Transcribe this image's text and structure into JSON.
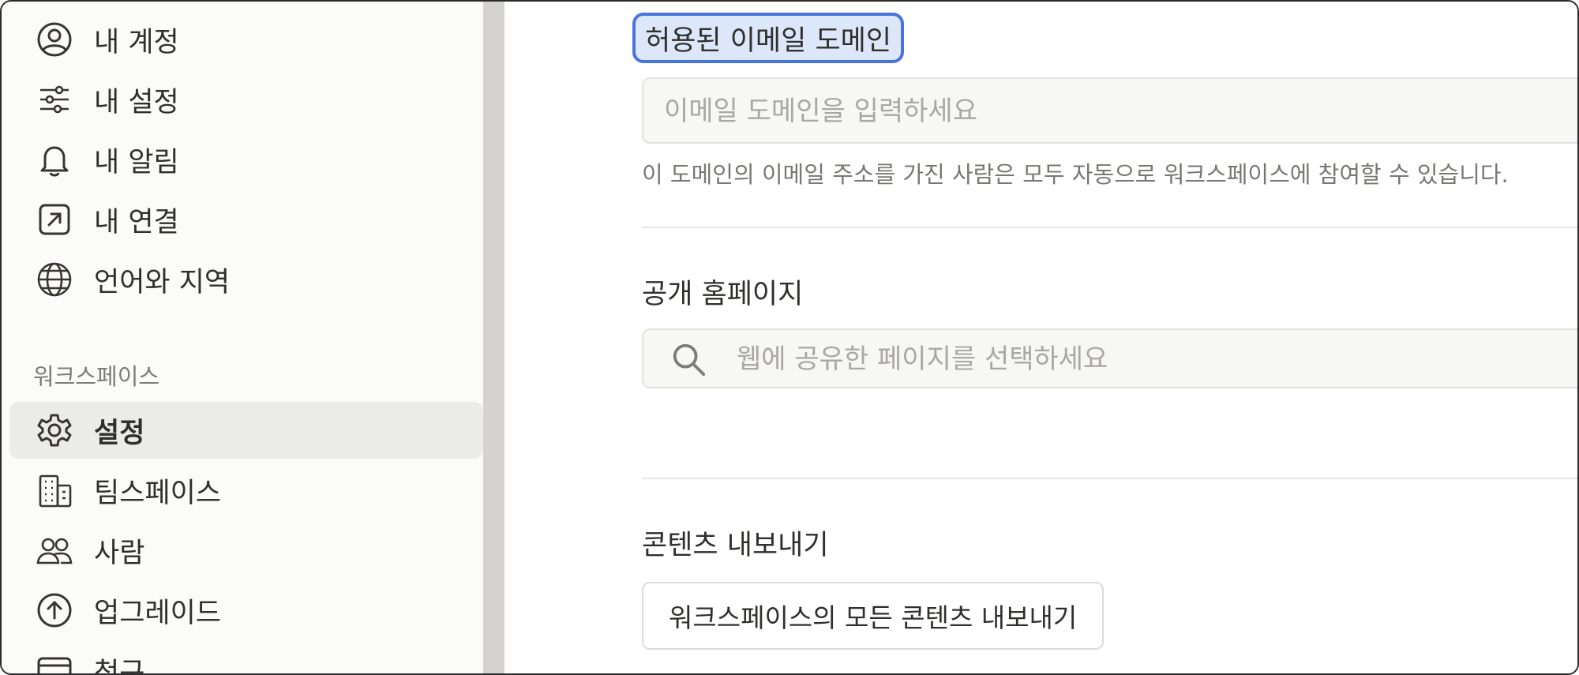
{
  "sidebar": {
    "account_items": [
      {
        "label": "내 계정",
        "icon": "account-circle-icon"
      },
      {
        "label": "내 설정",
        "icon": "sliders-icon"
      },
      {
        "label": "내 알림",
        "icon": "bell-icon"
      },
      {
        "label": "내 연결",
        "icon": "arrow-up-right-box-icon"
      },
      {
        "label": "언어와 지역",
        "icon": "globe-icon"
      }
    ],
    "workspace_section_label": "워크스페이스",
    "workspace_items": [
      {
        "label": "설정",
        "icon": "gear-icon",
        "active": true
      },
      {
        "label": "팀스페이스",
        "icon": "building-icon"
      },
      {
        "label": "사람",
        "icon": "people-icon"
      },
      {
        "label": "업그레이드",
        "icon": "arrow-up-circle-icon"
      },
      {
        "label": "청구",
        "icon": "credit-card-icon"
      }
    ]
  },
  "main": {
    "email_domain": {
      "title": "허용된 이메일 도메인",
      "placeholder": "이메일 도메인을 입력하세요",
      "helper": "이 도메인의 이메일 주소를 가진 사람은 모두 자동으로 워크스페이스에 참여할 수 있습니다."
    },
    "public_homepage": {
      "title": "공개 홈페이지",
      "placeholder": "웹에 공유한 페이지를 선택하세요"
    },
    "export": {
      "title": "콘텐츠 내보내기",
      "button_label": "워크스페이스의 모든 콘텐츠 내보내기"
    }
  },
  "colors": {
    "sidebar_bg": "#fbfbfa",
    "active_item_bg": "#ebebea",
    "highlight_bg": "#dde7fa",
    "highlight_border": "#4a74dd"
  }
}
